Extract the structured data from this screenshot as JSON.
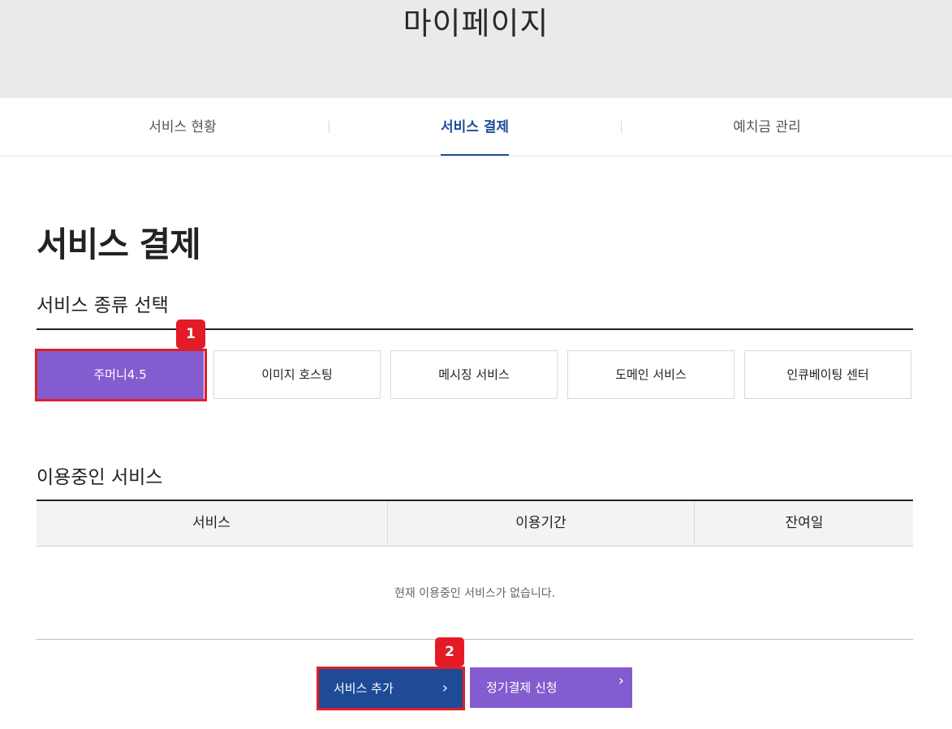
{
  "hero": {
    "title": "마이페이지"
  },
  "tabs": [
    {
      "label": "서비스 현황",
      "active": false
    },
    {
      "label": "서비스 결제",
      "active": true
    },
    {
      "label": "예치금 관리",
      "active": false
    }
  ],
  "page_title": "서비스 결제",
  "service_type": {
    "heading": "서비스 종류 선택",
    "options": [
      {
        "label": "주머니4.5",
        "selected": true
      },
      {
        "label": "이미지 호스팅",
        "selected": false
      },
      {
        "label": "메시징 서비스",
        "selected": false
      },
      {
        "label": "도메인 서비스",
        "selected": false
      },
      {
        "label": "인큐베이팅 센터",
        "selected": false
      }
    ]
  },
  "in_use": {
    "heading": "이용중인 서비스",
    "columns": [
      "서비스",
      "이용기간",
      "잔여일"
    ],
    "empty_message": "현재 이용중인 서비스가 없습니다."
  },
  "actions": {
    "add_label": "서비스 추가",
    "subscribe_label": "정기결제 신청"
  },
  "annotations": {
    "marker_1": "1",
    "marker_2": "2"
  },
  "colors": {
    "accent_purple": "#835ccf",
    "primary_blue": "#1f4b96",
    "highlight_red": "#e01e2b",
    "hero_bg": "#e9eaec"
  },
  "icons": {
    "chevron": "chevron-right-icon"
  }
}
